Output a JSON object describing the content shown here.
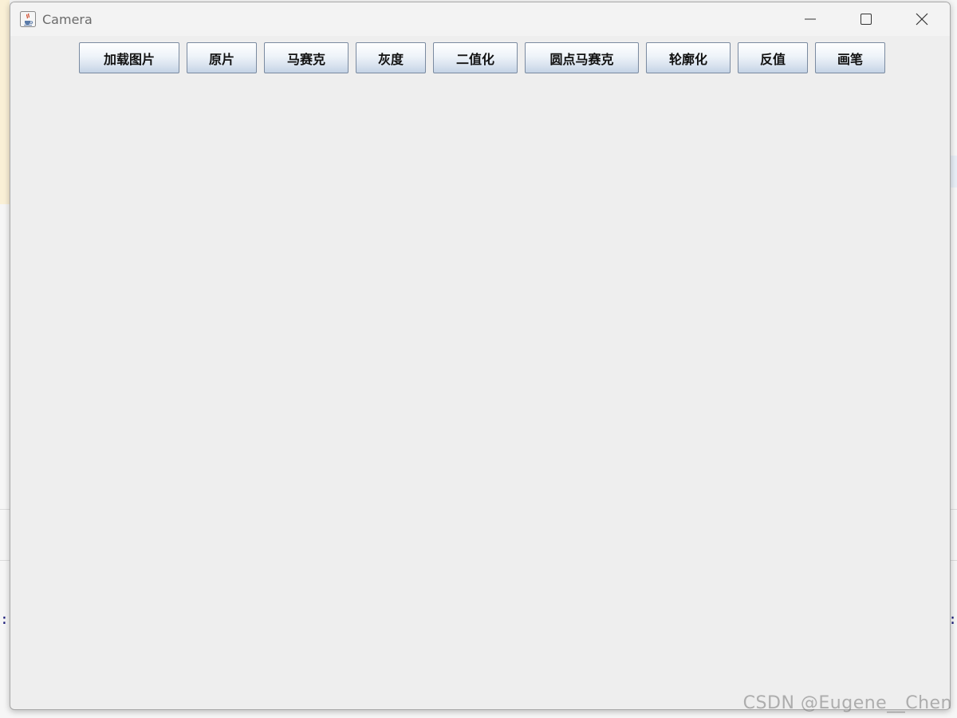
{
  "window": {
    "title": "Camera"
  },
  "toolbar": {
    "buttons": [
      {
        "label": "加载图片"
      },
      {
        "label": "原片"
      },
      {
        "label": "马赛克"
      },
      {
        "label": "灰度"
      },
      {
        "label": "二值化"
      },
      {
        "label": "圆点马赛克"
      },
      {
        "label": "轮廓化"
      },
      {
        "label": "反值"
      },
      {
        "label": "画笔"
      }
    ]
  },
  "icons": {
    "app": "java-coffee-icon",
    "minimize": "minimize-icon",
    "maximize": "maximize-icon",
    "close": "close-icon"
  },
  "watermark": "CSDN @Eugene__Chen"
}
